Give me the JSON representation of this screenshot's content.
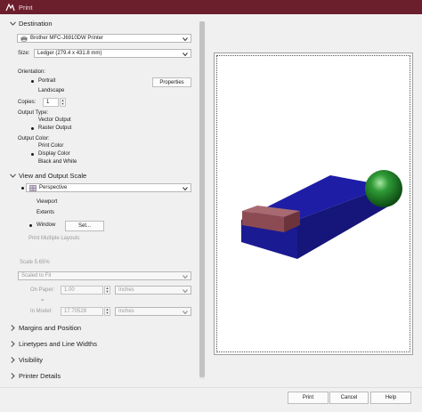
{
  "window": {
    "title": "Print"
  },
  "destination": {
    "header": "Destination",
    "printer": "Brother MFC-J6910DW Printer",
    "size_label": "Size:",
    "size_value": "Ledger (279.4 x 431.8 mm)",
    "orientation_label": "Orientation:",
    "orientation_options": [
      "Portrait",
      "Landscape"
    ],
    "orientation_selected": "Portrait",
    "properties_button": "Properties",
    "copies_label": "Copies:",
    "copies_value": "1",
    "output_type_label": "Output Type:",
    "output_type_options": [
      "Vector Output",
      "Raster Output"
    ],
    "output_type_selected": "Raster Output",
    "output_color_label": "Output Color:",
    "output_color_options": [
      "Print Color",
      "Display Color",
      "Black and White"
    ],
    "output_color_selected": "Display Color"
  },
  "view_scale": {
    "header": "View and Output Scale",
    "view_value": "Perspective",
    "area_options": [
      "Viewport",
      "Extents",
      "Window"
    ],
    "area_selected": "Window",
    "set_button": "Set...",
    "print_multiple_layouts": "Print Multiple Layouts",
    "scale_label": "Scale 5.65%",
    "scale_mode": "Scaled to Fit",
    "on_paper_label": "On Paper:",
    "on_paper_value": "1.00",
    "on_paper_unit": "Inches",
    "equals": "=",
    "in_model_label": "In Model:",
    "in_model_value": "17.70528",
    "in_model_unit": "Inches"
  },
  "collapsed_sections": [
    "Margins and Position",
    "Linetypes and Line Widths",
    "Visibility",
    "Printer Details"
  ],
  "buttons": {
    "print": "Print",
    "cancel": "Cancel",
    "help": "Help"
  },
  "colors": {
    "titlebar": "#6b1e2c",
    "box": "#1b1ba8",
    "lid": "#8b4a52",
    "sphere": "#1f8a2a"
  }
}
